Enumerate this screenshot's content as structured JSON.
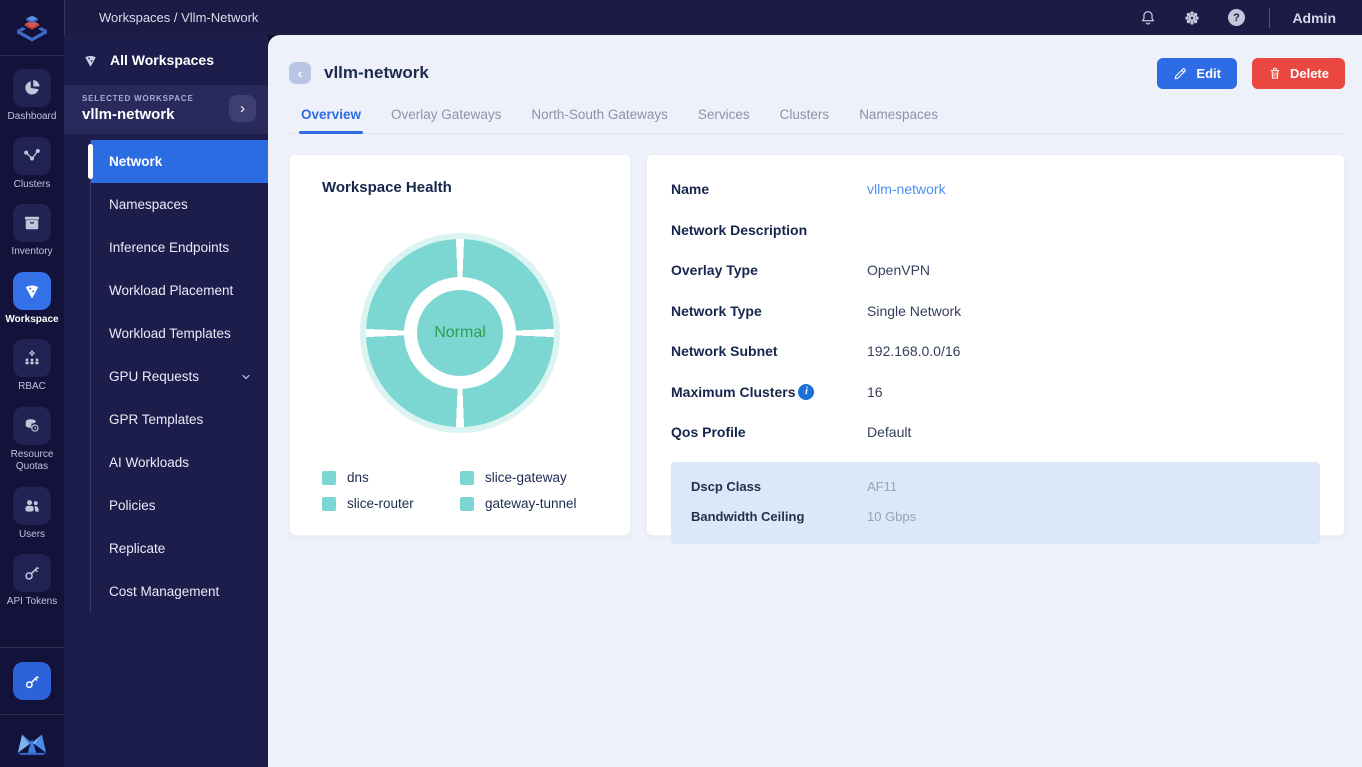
{
  "topbar": {
    "breadcrumb": "Workspaces / Vllm-Network",
    "admin_label": "Admin",
    "help_glyph": "?",
    "icons": [
      "bell-icon",
      "settings-icon",
      "help-icon"
    ]
  },
  "rail": {
    "items": [
      {
        "label": "Dashboard",
        "icon": "pie-chart-icon",
        "active": false
      },
      {
        "label": "Clusters",
        "icon": "cluster-nodes-icon",
        "active": false
      },
      {
        "label": "Inventory",
        "icon": "inventory-box-icon",
        "active": false
      },
      {
        "label": "Workspace",
        "icon": "workspace-slice-icon",
        "active": true
      },
      {
        "label": "RBAC",
        "icon": "rbac-gear-people-icon",
        "active": false
      },
      {
        "label": "Resource Quotas",
        "icon": "resource-quotas-icon",
        "active": false
      },
      {
        "label": "Users",
        "icon": "users-icon",
        "active": false
      },
      {
        "label": "API Tokens",
        "icon": "key-icon",
        "active": false
      }
    ],
    "bottom_button_icon": "key-icon",
    "brand_icon": "crown-logo"
  },
  "sidebar": {
    "all_workspaces_label": "All Workspaces",
    "selected_workspace_label": "SELECTED WORKSPACE",
    "selected_workspace_name": "vllm-network",
    "chevron_glyph": "›",
    "menu": [
      {
        "label": "Network",
        "active": true
      },
      {
        "label": "Namespaces",
        "active": false
      },
      {
        "label": "Inference Endpoints",
        "active": false
      },
      {
        "label": "Workload Placement",
        "active": false
      },
      {
        "label": "Workload Templates",
        "active": false
      },
      {
        "label": "GPU Requests",
        "active": false,
        "has_chevron": true
      },
      {
        "label": "GPR Templates",
        "active": false
      },
      {
        "label": "AI Workloads",
        "active": false
      },
      {
        "label": "Policies",
        "active": false
      },
      {
        "label": "Replicate",
        "active": false
      },
      {
        "label": "Cost Management",
        "active": false
      }
    ]
  },
  "main": {
    "back_glyph": "‹",
    "title": "vllm-network",
    "edit_label": "Edit",
    "delete_label": "Delete",
    "tabs": [
      {
        "label": "Overview",
        "active": true
      },
      {
        "label": "Overlay Gateways",
        "active": false
      },
      {
        "label": "North-South Gateways",
        "active": false
      },
      {
        "label": "Services",
        "active": false
      },
      {
        "label": "Clusters",
        "active": false
      },
      {
        "label": "Namespaces",
        "active": false
      }
    ],
    "health_card": {
      "title": "Workspace Health",
      "status": "Normal",
      "legend": [
        {
          "label": "dns"
        },
        {
          "label": "slice-gateway"
        },
        {
          "label": "slice-router"
        },
        {
          "label": "gateway-tunnel"
        }
      ]
    },
    "details": {
      "rows": [
        {
          "label": "Name",
          "value": "vllm-network"
        },
        {
          "label": "Network Description",
          "value": ""
        },
        {
          "label": "Overlay Type",
          "value": "OpenVPN"
        },
        {
          "label": "Network Type",
          "value": "Single Network"
        },
        {
          "label": "Network Subnet",
          "value": "192.168.0.0/16"
        },
        {
          "label": "Maximum Clusters",
          "value": "16",
          "has_info": true
        },
        {
          "label": "Qos Profile",
          "value": "Default"
        }
      ],
      "qos_rows": [
        {
          "label": "Dscp Class",
          "value": "AF11"
        },
        {
          "label": "Bandwidth Ceiling",
          "value": "10 Gbps"
        }
      ]
    }
  },
  "chart_data": {
    "type": "pie",
    "title": "Workspace Health",
    "categories": [
      "dns",
      "slice-gateway",
      "slice-router",
      "gateway-tunnel"
    ],
    "values": [
      25,
      25,
      25,
      25
    ],
    "center_label": "Normal",
    "legend_position": "bottom",
    "colors": [
      "#7cd7d2",
      "#7cd7d2",
      "#7cd7d2",
      "#7cd7d2"
    ]
  },
  "colors": {
    "topbar_bg": "#1b1b45",
    "rail_bg": "#12123a",
    "sidebar_bg": "#1d1d4c",
    "selected_panel_bg": "#29295c",
    "accent_blue": "#2d6ce5",
    "delete_red": "#e9473f",
    "main_bg": "#eef1f9",
    "teal": "#7cd7d2",
    "status_green": "#2f9e4f",
    "qos_box_bg": "#dce7fa",
    "link_blue": "#4f8df2"
  }
}
